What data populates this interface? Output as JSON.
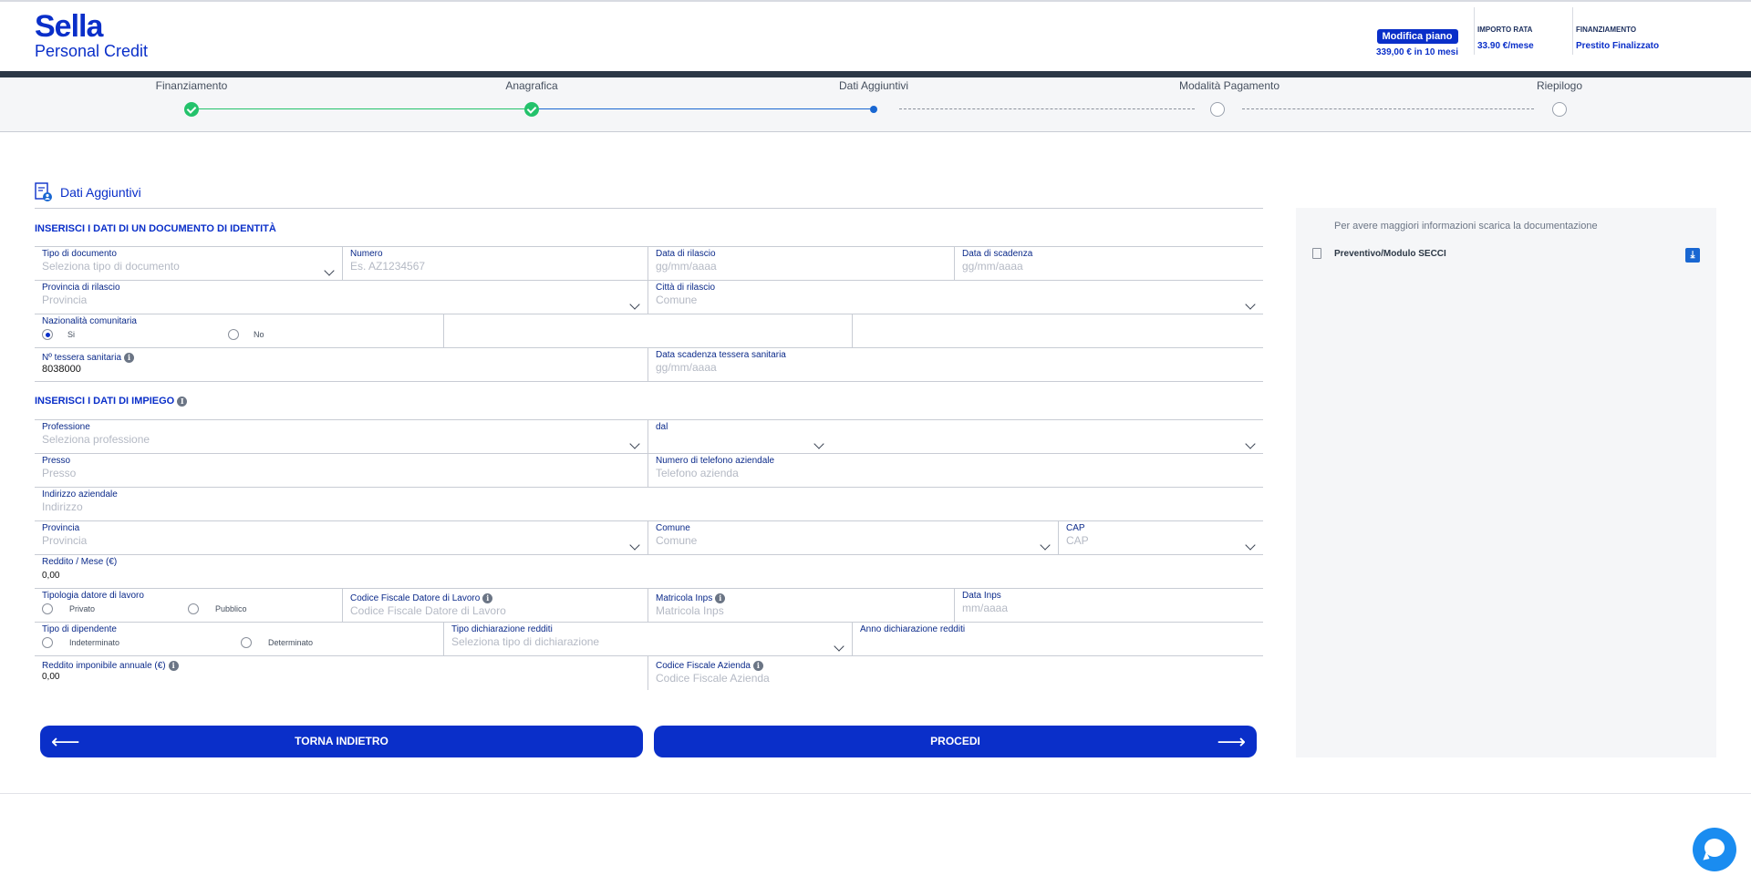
{
  "brand": {
    "name_line1": "Sella",
    "name_line2": "Personal Credit"
  },
  "header": {
    "modify_plan_label": "Modifica piano",
    "plan_summary": "339,00 € in 10 mesi",
    "importo_rata_caption": "IMPORTO RATA",
    "importo_rata_value": "33.90 €/mese",
    "finanziamento_caption": "FINANZIAMENTO",
    "finanziamento_value": "Prestito Finalizzato"
  },
  "steps": [
    {
      "label": "Finanziamento",
      "state": "done"
    },
    {
      "label": "Anagrafica",
      "state": "done"
    },
    {
      "label": "Dati Aggiuntivi",
      "state": "current"
    },
    {
      "label": "Modalità Pagamento",
      "state": "todo"
    },
    {
      "label": "Riepilogo",
      "state": "todo"
    }
  ],
  "section_title": "Dati Aggiuntivi",
  "documento": {
    "title": "INSERISCI I DATI DI UN DOCUMENTO DI IDENTITÀ",
    "tipo_documento": {
      "label": "Tipo di documento",
      "placeholder": "Seleziona tipo di documento"
    },
    "numero": {
      "label": "Numero",
      "placeholder": "Es. AZ1234567"
    },
    "data_rilascio": {
      "label": "Data di rilascio",
      "placeholder": "gg/mm/aaaa"
    },
    "data_scadenza": {
      "label": "Data di scadenza",
      "placeholder": "gg/mm/aaaa"
    },
    "provincia_rilascio": {
      "label": "Provincia di rilascio",
      "placeholder": "Provincia"
    },
    "citta_rilascio": {
      "label": "Città di rilascio",
      "placeholder": "Comune"
    },
    "nazionalita": {
      "label": "Nazionalità comunitaria",
      "option_yes": "Si",
      "option_no": "No",
      "selected": "Si"
    },
    "tessera": {
      "label": "Nº tessera sanitaria",
      "value": "8038000"
    },
    "scadenza_tessera": {
      "label": "Data scadenza tessera sanitaria",
      "placeholder": "gg/mm/aaaa"
    }
  },
  "impiego": {
    "title": "INSERISCI I DATI DI IMPIEGO",
    "professione": {
      "label": "Professione",
      "placeholder": "Seleziona professione"
    },
    "dal": {
      "label": "dal"
    },
    "presso": {
      "label": "Presso",
      "placeholder": "Presso"
    },
    "telefono": {
      "label": "Numero di telefono aziendale",
      "placeholder": "Telefono azienda"
    },
    "indirizzo": {
      "label": "Indirizzo aziendale",
      "placeholder": "Indirizzo"
    },
    "provincia": {
      "label": "Provincia",
      "placeholder": "Provincia"
    },
    "comune": {
      "label": "Comune",
      "placeholder": "Comune"
    },
    "cap": {
      "label": "CAP",
      "placeholder": "CAP"
    },
    "reddito": {
      "label": "Reddito / Mese (€)",
      "value": "0,00"
    },
    "tipologia_datore": {
      "label": "Tipologia datore di lavoro",
      "option_a": "Privato",
      "option_b": "Pubblico"
    },
    "cf_datore": {
      "label": "Codice Fiscale Datore di Lavoro",
      "placeholder": "Codice Fiscale Datore di Lavoro"
    },
    "matricola": {
      "label": "Matricola Inps",
      "placeholder": "Matricola Inps"
    },
    "data_inps": {
      "label": "Data Inps",
      "placeholder": "mm/aaaa"
    },
    "tipo_dipendente": {
      "label": "Tipo di dipendente",
      "option_a": "Indeterminato",
      "option_b": "Determinato"
    },
    "tipo_dichiarazione": {
      "label": "Tipo dichiarazione redditi",
      "placeholder": "Seleziona tipo di dichiarazione"
    },
    "anno_dichiarazione": {
      "label": "Anno dichiarazione redditi"
    },
    "reddito_annuale": {
      "label": "Reddito imponibile annuale (€)",
      "value": "0,00"
    },
    "cf_azienda": {
      "label": "Codice Fiscale Azienda",
      "placeholder": "Codice Fiscale Azienda"
    }
  },
  "buttons": {
    "back": "TORNA INDIETRO",
    "next": "PROCEDI"
  },
  "sidebar": {
    "info_text": "Per avere maggiori informazioni scarica la documentazione",
    "doc_label": "Preventivo/Modulo SECCI"
  },
  "colors": {
    "primary": "#0a2fc9",
    "success": "#23c26b",
    "step_current": "#1967d2",
    "chat": "#1a8cf0"
  }
}
